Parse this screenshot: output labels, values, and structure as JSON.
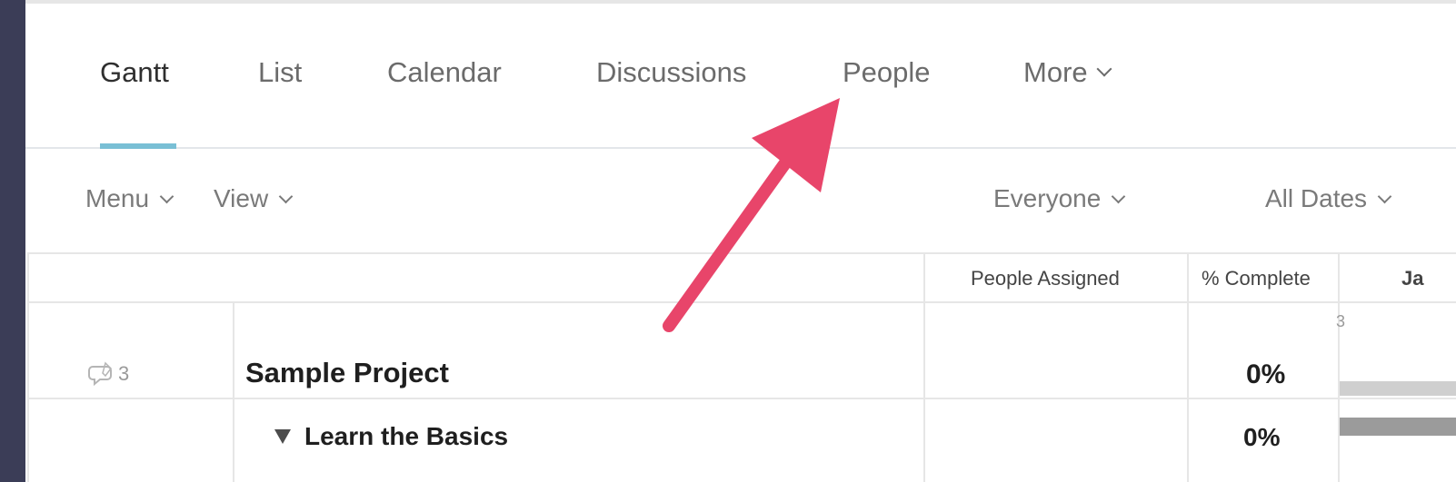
{
  "tabs": [
    {
      "label": "Gantt",
      "active": true
    },
    {
      "label": "List"
    },
    {
      "label": "Calendar"
    },
    {
      "label": "Discussions"
    },
    {
      "label": "People"
    },
    {
      "label": "More"
    }
  ],
  "toolbar": {
    "menu_label": "Menu",
    "view_label": "View",
    "everyone_label": "Everyone",
    "all_dates_label": "All Dates"
  },
  "columns": {
    "people_assigned": "People Assigned",
    "percent_complete": "% Complete",
    "month_partial": "Ja",
    "date_tick": "3"
  },
  "rows": [
    {
      "title": "Sample Project",
      "comments": "3",
      "percent": "0%"
    },
    {
      "title": "Learn the Basics",
      "percent": "0%"
    }
  ],
  "colors": {
    "rail": "#3b3d57",
    "active_tab_underline": "#79bfd5",
    "arrow": "#e8456a",
    "bar_light": "#cfcfcf",
    "bar_dark": "#9b9b9b"
  },
  "icons": {
    "comment": "comment-bubble-icon",
    "chevron": "chevron-down-icon",
    "triangle": "caret-down-icon",
    "arrow": "pointer-arrow-icon"
  }
}
